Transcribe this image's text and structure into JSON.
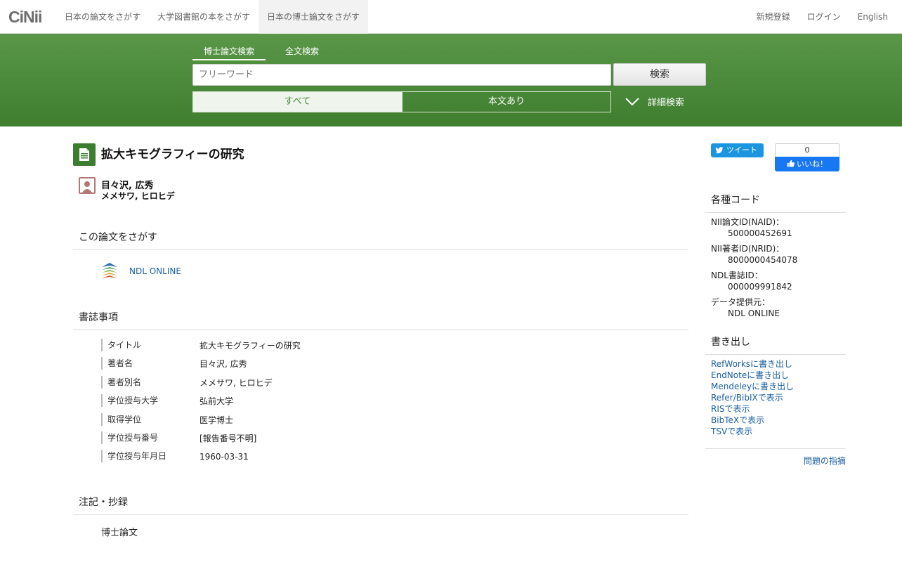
{
  "brand": "CiNii",
  "nav": {
    "tabs": [
      "日本の論文をさがす",
      "大学図書館の本をさがす",
      "日本の博士論文をさがす"
    ],
    "right": [
      "新規登録",
      "ログイン",
      "English"
    ]
  },
  "search": {
    "tabs": [
      "博士論文検索",
      "全文検索"
    ],
    "placeholder": "フリーワード",
    "button": "検索",
    "filters": [
      "すべて",
      "本文あり"
    ],
    "advanced": "詳細検索"
  },
  "paper": {
    "title": "拡大キモグラフィーの研究",
    "author": "目々沢, 広秀",
    "author_kana": "メメサワ, ヒロヒデ"
  },
  "find": {
    "heading": "この論文をさがす",
    "link": "NDL ONLINE"
  },
  "biblio": {
    "heading": "書誌事項",
    "rows": [
      {
        "key": "タイトル",
        "value": "拡大キモグラフィーの研究"
      },
      {
        "key": "著者名",
        "value": "目々沢, 広秀"
      },
      {
        "key": "著者別名",
        "value": "メメサワ, ヒロヒデ"
      },
      {
        "key": "学位授与大学",
        "value": "弘前大学"
      },
      {
        "key": "取得学位",
        "value": "医学博士"
      },
      {
        "key": "学位授与番号",
        "value": "[報告番号不明]"
      },
      {
        "key": "学位授与年月日",
        "value": "1960-03-31"
      }
    ]
  },
  "notes": {
    "heading": "注記・抄録",
    "text": "博士論文"
  },
  "social": {
    "tweet": "ツイート",
    "like_count": "0",
    "like": "いいね！"
  },
  "codes": {
    "heading": "各種コード",
    "items": [
      {
        "key": "NII論文ID(NAID)：",
        "value": "500000452691"
      },
      {
        "key": "NII著者ID(NRID)：",
        "value": "8000000454078"
      },
      {
        "key": "NDL書誌ID：",
        "value": "000009991842"
      },
      {
        "key": "データ提供元：",
        "value": "NDL ONLINE"
      }
    ]
  },
  "export": {
    "heading": "書き出し",
    "links": [
      "RefWorksに書き出し",
      "EndNoteに書き出し",
      "Mendeleyに書き出し",
      "Refer/BibIXで表示",
      "RISで表示",
      "BibTeXで表示",
      "TSVで表示"
    ]
  },
  "report": "問題の指摘",
  "colors": {
    "green": "#3e7e2e",
    "link": "#1a5fa0",
    "author_icon": "#b47777"
  }
}
